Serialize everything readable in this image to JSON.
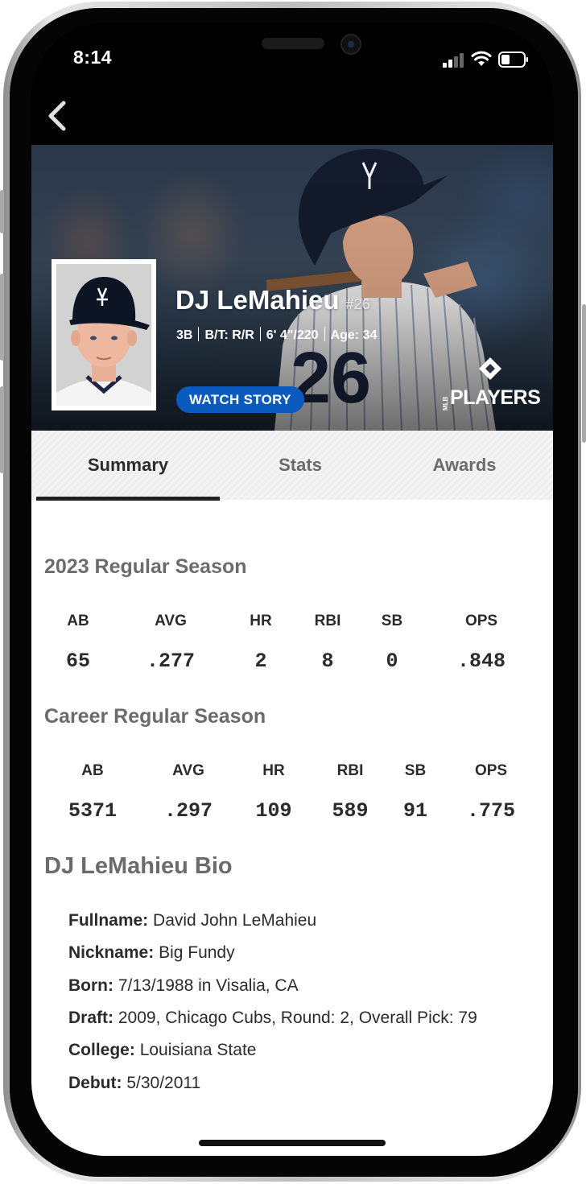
{
  "status_bar": {
    "time": "8:14"
  },
  "player": {
    "name": "DJ LeMahieu",
    "number": "#26",
    "position": "3B",
    "bats_throws": "B/T: R/R",
    "height_weight": "6' 4\"/220",
    "age": "Age: 34",
    "watch_story_label": "WATCH STORY"
  },
  "logo": {
    "text": "PLAYERS",
    "small": "MLB"
  },
  "tabs": [
    {
      "label": "Summary",
      "active": true
    },
    {
      "label": "Stats",
      "active": false
    },
    {
      "label": "Awards",
      "active": false
    }
  ],
  "season_stats": {
    "title": "2023 Regular Season",
    "headers": [
      "AB",
      "AVG",
      "HR",
      "RBI",
      "SB",
      "OPS"
    ],
    "values": [
      "65",
      ".277",
      "2",
      "8",
      "0",
      ".848"
    ]
  },
  "career_stats": {
    "title": "Career Regular Season",
    "headers": [
      "AB",
      "AVG",
      "HR",
      "RBI",
      "SB",
      "OPS"
    ],
    "values": [
      "5371",
      ".297",
      "109",
      "589",
      "91",
      ".775"
    ]
  },
  "bio": {
    "title": "DJ LeMahieu Bio",
    "rows": [
      {
        "label": "Fullname:",
        "value": "David John LeMahieu"
      },
      {
        "label": "Nickname:",
        "value": "Big Fundy"
      },
      {
        "label": "Born:",
        "value": "7/13/1988 in Visalia, CA"
      },
      {
        "label": "Draft:",
        "value": "2009, Chicago Cubs, Round: 2, Overall Pick: 79"
      },
      {
        "label": "College:",
        "value": "Louisiana State"
      },
      {
        "label": "Debut:",
        "value": "5/30/2011"
      }
    ]
  },
  "colors": {
    "accent_blue": "#0a5bbd",
    "text_dark": "#2b2b2b",
    "text_gray": "#6b6b6b"
  }
}
